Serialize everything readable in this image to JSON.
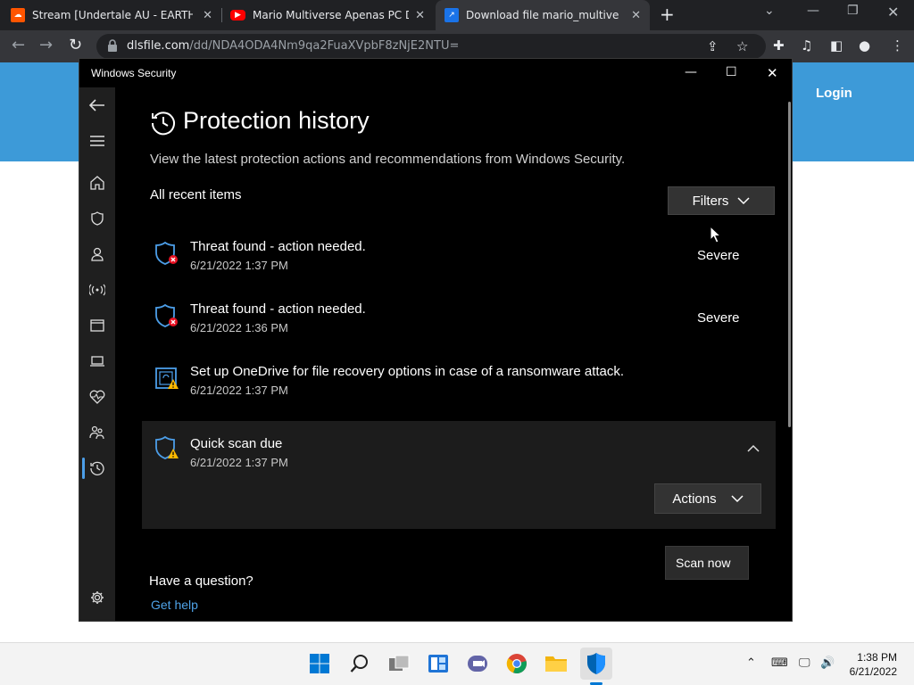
{
  "browser": {
    "tabs": [
      {
        "title": "Stream [Undertale AU - EARTHSE",
        "favicon": "soundcloud-icon",
        "favicon_color": "#ff5500"
      },
      {
        "title": "Mario Multiverse Apenas PC Dow",
        "favicon": "youtube-icon",
        "favicon_color": "#ff0000"
      },
      {
        "title": "Download file mario_multiverse_",
        "favicon": "dlsfile-icon",
        "favicon_color": "#1a73e8"
      }
    ],
    "url_host": "dlsfile.com",
    "url_path": "/dd/NDA4ODA4Nm9qa2FuaXVpbF8zNjE2NTU="
  },
  "page": {
    "login_label": "Login",
    "header_color": "#3d9ad8"
  },
  "window": {
    "app_title": "Windows Security",
    "title": "Protection history",
    "subtitle": "View the latest protection actions and recommendations from Windows Security.",
    "section_label": "All recent items",
    "filters_label": "Filters",
    "items": [
      {
        "title": "Threat found - action needed.",
        "time": "6/21/2022 1:37 PM",
        "severity": "Severe",
        "icon": "shield-error-icon"
      },
      {
        "title": "Threat found - action needed.",
        "time": "6/21/2022 1:36 PM",
        "severity": "Severe",
        "icon": "shield-error-icon"
      },
      {
        "title": "Set up OneDrive for file recovery options in case of a ransomware attack.",
        "time": "6/21/2022 1:37 PM",
        "severity": "",
        "icon": "onedrive-warning-icon"
      },
      {
        "title": "Quick scan due",
        "time": "6/21/2022 1:37 PM",
        "severity": "",
        "icon": "shield-warning-icon"
      }
    ],
    "actions_label": "Actions",
    "menu_item": "Scan now",
    "question": "Have a question?",
    "help_link": "Get help",
    "accent_color": "#4c9ee8"
  },
  "taskbar": {
    "time": "1:38 PM",
    "date": "6/21/2022"
  }
}
